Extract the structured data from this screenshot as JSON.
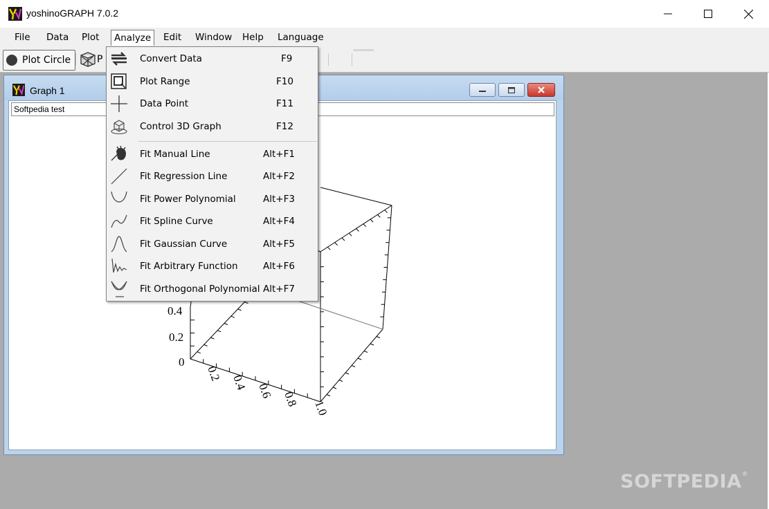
{
  "window": {
    "title": "yoshinoGRAPH 7.0.2"
  },
  "menubar": {
    "items": [
      "File",
      "Data",
      "Plot",
      "Analyze",
      "Edit",
      "Window",
      "Help",
      "Language"
    ],
    "active": "Analyze"
  },
  "toolbar": {
    "plot_circle_label": "Plot Circle",
    "second_button_label": "P"
  },
  "graph_window": {
    "title": "Graph 1",
    "graph_title_field": "Softpedia test",
    "z_ticks": [
      "0.4",
      "0.2",
      "0"
    ],
    "x_ticks": [
      "0.2",
      "0.4",
      "0.6",
      "0.8",
      "1.0"
    ]
  },
  "analyze_menu": {
    "items": [
      {
        "label": "Convert Data",
        "shortcut": "F9",
        "icon": "convert-data-icon"
      },
      {
        "label": "Plot Range",
        "shortcut": "F10",
        "icon": "plot-range-icon"
      },
      {
        "label": "Data Point",
        "shortcut": "F11",
        "icon": "data-point-icon"
      },
      {
        "label": "Control 3D Graph",
        "shortcut": "F12",
        "icon": "control-3d-icon"
      },
      {
        "label": "Fit Manual Line",
        "shortcut": "Alt+F1",
        "icon": "manual-line-icon"
      },
      {
        "label": "Fit Regression Line",
        "shortcut": "Alt+F2",
        "icon": "regression-line-icon"
      },
      {
        "label": "Fit Power Polynomial",
        "shortcut": "Alt+F3",
        "icon": "power-polynomial-icon"
      },
      {
        "label": "Fit Spline Curve",
        "shortcut": "Alt+F4",
        "icon": "spline-curve-icon"
      },
      {
        "label": "Fit Gaussian Curve",
        "shortcut": "Alt+F5",
        "icon": "gaussian-curve-icon"
      },
      {
        "label": "Fit Arbitrary Function",
        "shortcut": "Alt+F6",
        "icon": "arbitrary-function-icon"
      },
      {
        "label": "Fit Orthogonal Polynomial",
        "shortcut": "Alt+F7",
        "icon": "orthogonal-polynomial-icon"
      }
    ]
  },
  "watermark": {
    "text": "SOFTPEDIA",
    "mark": "®"
  },
  "colors": {
    "mdi_background": "#ababab",
    "child_frame": "#bcd3ec",
    "close_button": "#d9453a"
  }
}
